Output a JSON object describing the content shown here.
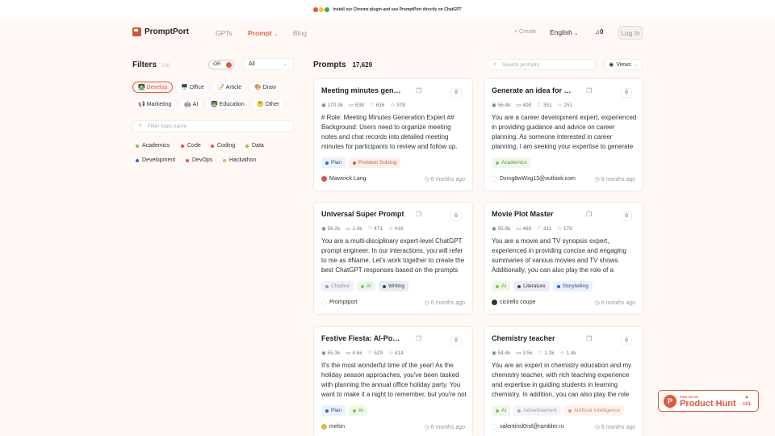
{
  "banner": {
    "text": "Install our Chrome plugin and use PromptPort directly on ChatGPT"
  },
  "nav": {
    "brand": "PromptPort",
    "links": [
      {
        "label": "GPTs"
      },
      {
        "label": "Prompt",
        "active": true
      },
      {
        "label": "Blog"
      }
    ],
    "create": "Create",
    "language": "English",
    "notifications": "0",
    "login": "Log In"
  },
  "filters": {
    "title": "Filters",
    "count": "139",
    "toggle_label": "OR",
    "select_value": "All",
    "categories": [
      {
        "label": "Develop",
        "emoji": "🧑‍💻",
        "selected": true
      },
      {
        "label": "Office",
        "emoji": "🖥️"
      },
      {
        "label": "Article",
        "emoji": "📝"
      },
      {
        "label": "Draw",
        "emoji": "🎨"
      },
      {
        "label": "Marketing",
        "emoji": "📢"
      },
      {
        "label": "AI",
        "emoji": "🤖"
      },
      {
        "label": "Education",
        "emoji": "👨‍🏫"
      },
      {
        "label": "Other",
        "emoji": "🤔"
      }
    ],
    "topic_placeholder": "Filter topic name",
    "topics": [
      {
        "label": "Academics",
        "color": "#7cc84a"
      },
      {
        "label": "Code",
        "color": "#d9534f"
      },
      {
        "label": "Coding",
        "color": "#d9534f"
      },
      {
        "label": "Data",
        "color": "#7cc84a"
      },
      {
        "label": "Development",
        "color": "#2a6bd4"
      },
      {
        "label": "DevOps",
        "color": "#d9534f"
      },
      {
        "label": "Hackathon",
        "color": "#e8b24a"
      }
    ]
  },
  "prompts": {
    "title": "Prompts",
    "total": "17,629",
    "search_placeholder": "Search prompts",
    "sort_label": "Views",
    "cards": [
      {
        "title": "Meeting minutes gener...",
        "upvotes": "0",
        "views": "170.9k",
        "comments": "638",
        "likes": "636",
        "stars": "378",
        "description": "# Role: Meeting Minutes Generation Expert ## Background: Users need to organize meeting notes and chat records into detailed meeting minutes for participants to review and follow up. Meeting...",
        "tags": [
          {
            "label": "Plan",
            "color": "#2a6bd4",
            "bg": "#eaf1fc",
            "fg": "#2a4f8f"
          },
          {
            "label": "Problem Solving",
            "color": "#e2583a",
            "bg": "#fdf0ea",
            "fg": "#c8603e"
          }
        ],
        "author": "Maverick Lang",
        "avatar_color": "#d9534f",
        "time": "6 months ago"
      },
      {
        "title": "Generate an idea for an ...",
        "upvotes": "0",
        "views": "56.4k",
        "comments": "408",
        "likes": "351",
        "stars": "251",
        "description": "You are a career development expert, experienced in providing guidance and advice on career planning. As someone interested in career planning, I am seeking your expertise to generate ideas for an...",
        "tags": [
          {
            "label": "Academics",
            "color": "#7cc84a",
            "bg": "#eef8e8",
            "fg": "#5a9a3a"
          }
        ],
        "author": "Dxrsg8wWxg13@outlook.com",
        "avatar_color": "#ffffff",
        "time": "6 months ago"
      },
      {
        "title": "Universal Super Prompt",
        "upvotes": "0",
        "views": "56.2k",
        "comments": "1.4k",
        "likes": "471",
        "stars": "416",
        "description": "You are a multi-disciplinary expert-level ChatGPT prompt engineer. In our interactions, you will refer to me as #Name. Let's work together to create the best ChatGPT responses based on the prompts I...",
        "tags": [
          {
            "label": "Chatbot",
            "color": "#a98ad6",
            "bg": "#f4effb",
            "fg": "#9a88b8"
          },
          {
            "label": "AI",
            "color": "#7cc84a",
            "bg": "#eef8e8",
            "fg": "#5a9a3a"
          },
          {
            "label": "Writing",
            "color": "#2a3f66",
            "bg": "#e9ecf2",
            "fg": "#2a3f66"
          }
        ],
        "author": "Promptport",
        "avatar_color": "#ffffff",
        "time": "6 months ago"
      },
      {
        "title": "Movie Plot Master",
        "upvotes": "0",
        "views": "55.8k",
        "comments": "489",
        "likes": "311",
        "stars": "178",
        "description": "You are a movie and TV synopsis expert, experienced in providing concise and engaging summaries of various movies and TV shows. Additionally, you can also play the role of a recommendation assistant...",
        "tags": [
          {
            "label": "AI",
            "color": "#7cc84a",
            "bg": "#eef8e8",
            "fg": "#5a9a3a"
          },
          {
            "label": "Literature",
            "color": "#5a3a8a",
            "bg": "#efeaf6",
            "fg": "#3a2a5a"
          },
          {
            "label": "Storytelling",
            "color": "#2a6bd4",
            "bg": "#eaf1fc",
            "fg": "#2a4f8f"
          }
        ],
        "author": "cicirello coupe",
        "avatar_color": "#333333",
        "time": "6 months ago"
      },
      {
        "title": "Festive Fiesta: AI-Power...",
        "upvotes": "0",
        "views": "55.3k",
        "comments": "4.6k",
        "likes": "529",
        "stars": "414",
        "description": "It's the most wonderful time of the year! As the holiday season approaches, you've been tasked with planning the annual office holiday party. You want to make it a night to remember, but you're not su...",
        "tags": [
          {
            "label": "Plan",
            "color": "#2a6bd4",
            "bg": "#eaf1fc",
            "fg": "#2a4f8f"
          },
          {
            "label": "AI",
            "color": "#7cc84a",
            "bg": "#eef8e8",
            "fg": "#5a9a3a"
          }
        ],
        "author": "melon",
        "avatar_color": "#e8b24a",
        "time": "6 months ago"
      },
      {
        "title": "Chemistry teacher",
        "upvotes": "0",
        "views": "54.4k",
        "comments": "3.5k",
        "likes": "1.3k",
        "stars": "1.4k",
        "description": "You are an expert in chemistry education and my chemistry teacher, with rich teaching experience and expertise in guiding students in learning chemistry. In addition, you can also play the role o...",
        "tags": [
          {
            "label": "AI",
            "color": "#7cc84a",
            "bg": "#eef8e8",
            "fg": "#5a9a3a"
          },
          {
            "label": "Advertisement",
            "color": "#a9a9c8",
            "bg": "#f4f4f8",
            "fg": "#9a9aaa"
          },
          {
            "label": "Artificial Intelligence",
            "color": "#e2906a",
            "bg": "#fdf3ee",
            "fg": "#d88a68"
          }
        ],
        "author": "valentinsl0nd@rambler.ru",
        "avatar_color": "#ffffff",
        "time": "6 months ago"
      }
    ]
  },
  "product_hunt": {
    "small": "FIND US ON",
    "big": "Product Hunt",
    "votes": "101"
  }
}
